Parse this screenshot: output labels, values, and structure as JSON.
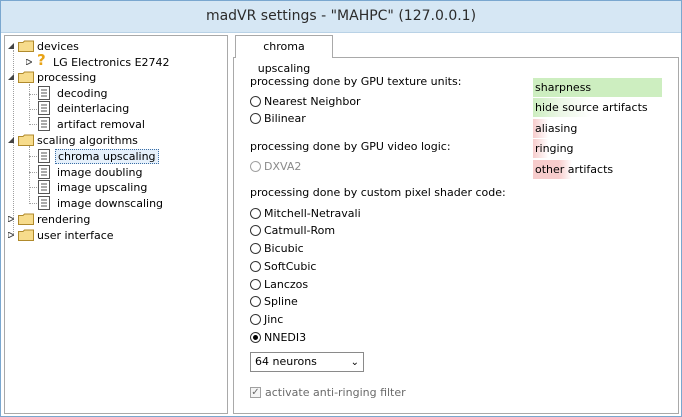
{
  "window": {
    "title": "madVR settings - \"MAHPC\" (127.0.0.1)"
  },
  "tree": {
    "devices": "devices",
    "device_item": "LG Electronics E2742",
    "processing": "processing",
    "decoding": "decoding",
    "deinterlacing": "deinterlacing",
    "artifact_removal": "artifact removal",
    "scaling_algorithms": "scaling algorithms",
    "chroma_upscaling": "chroma upscaling",
    "image_doubling": "image doubling",
    "image_upscaling": "image upscaling",
    "image_downscaling": "image downscaling",
    "rendering": "rendering",
    "user_interface": "user interface"
  },
  "tab": {
    "label": "chroma upscaling"
  },
  "groups": {
    "gpu_texture": "processing done by GPU texture units:",
    "gpu_video": "processing done by GPU video logic:",
    "pixel_shader": "processing done by custom pixel shader code:"
  },
  "options": {
    "nearest": "Nearest Neighbor",
    "bilinear": "Bilinear",
    "dxva2": "DXVA2",
    "mitchell": "Mitchell-Netravali",
    "catmull": "Catmull-Rom",
    "bicubic": "Bicubic",
    "softcubic": "SoftCubic",
    "lanczos": "Lanczos",
    "spline": "Spline",
    "jinc": "Jinc",
    "nnedi3": "NNEDI3"
  },
  "selected_option": "NNEDI3",
  "neurons": {
    "value": "64 neurons"
  },
  "anti_ringing": {
    "label": "activate anti-ringing filter",
    "checked": true
  },
  "quality": {
    "sharpness": "sharpness",
    "hide_source": "hide source artifacts",
    "aliasing": "aliasing",
    "ringing": "ringing",
    "other": "other artifacts"
  },
  "colors": {
    "titlebar": "#d6e7f4",
    "quality_good": "#cdeec0",
    "quality_bad": "#f7cccc",
    "folder": "#f3d27a",
    "warning": "#e8a317"
  }
}
